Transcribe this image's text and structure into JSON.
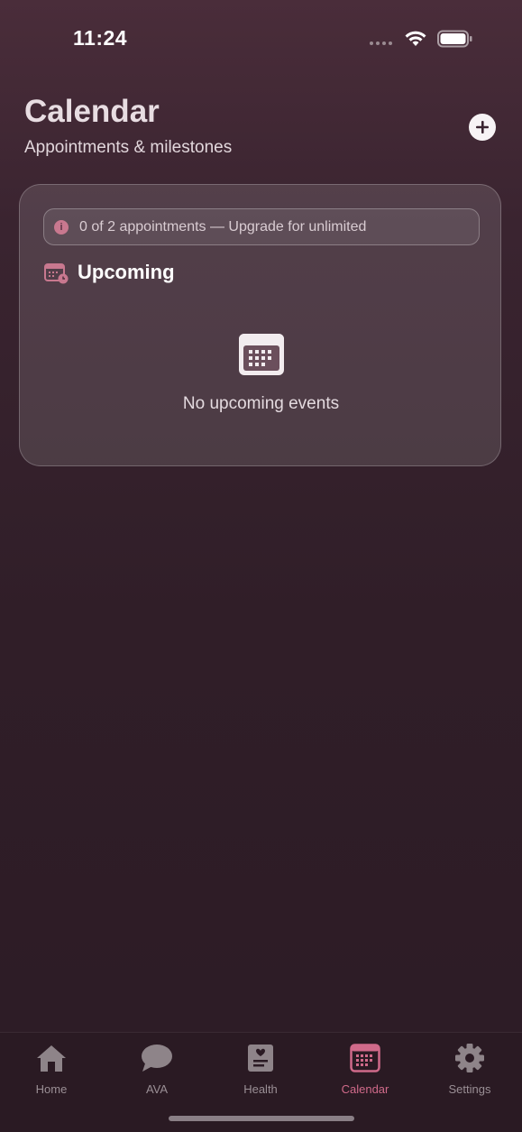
{
  "status_bar": {
    "time": "11:24"
  },
  "header": {
    "title": "Calendar",
    "subtitle": "Appointments & milestones",
    "add_icon": "plus-circle-icon"
  },
  "card": {
    "banner_text": "0 of 2 appointments — Upgrade for unlimited",
    "banner_icon": "info-icon",
    "section_title": "Upcoming",
    "section_icon": "calendar-clock-icon",
    "empty_icon": "calendar-icon",
    "empty_text": "No upcoming events"
  },
  "tabs": [
    {
      "label": "Home",
      "icon": "home-icon",
      "active": false
    },
    {
      "label": "AVA",
      "icon": "chat-bubble-icon",
      "active": false
    },
    {
      "label": "Health",
      "icon": "health-record-icon",
      "active": false
    },
    {
      "label": "Calendar",
      "icon": "calendar-icon",
      "active": true
    },
    {
      "label": "Settings",
      "icon": "gear-icon",
      "active": false
    }
  ],
  "colors": {
    "accent": "#d06a8a",
    "inactive": "#9a8f95"
  }
}
